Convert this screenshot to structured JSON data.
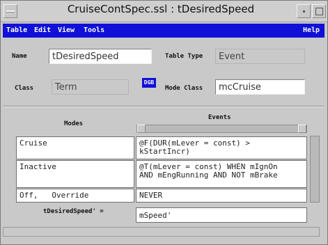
{
  "window": {
    "title": "CruiseContSpec.ssl : tDesiredSpeed"
  },
  "menubar": {
    "items": [
      "Table",
      "Edit",
      "View",
      "Tools"
    ],
    "help": "Help"
  },
  "form": {
    "name_label": "Name",
    "name_value": "tDesiredSpeed",
    "table_type_label": "Table Type",
    "table_type_value": "Event",
    "class_label": "Class",
    "class_value": "Term",
    "dgb_label": "DGB",
    "mode_class_label": "Mode Class",
    "mode_class_value": "mcCruise"
  },
  "table": {
    "modes_header": "Modes",
    "events_header": "Events",
    "rows": [
      {
        "mode": "Cruise",
        "event": "@F(DUR(mLever = const) >\nkStartIncr)"
      },
      {
        "mode": "Inactive",
        "event": "@T(mLever = const) WHEN mIgnOn\nAND mEngRunning AND NOT mBrake"
      },
      {
        "mode": "Off,   Override",
        "event": "NEVER"
      }
    ],
    "result_label": "tDesiredSpeed' =",
    "result_value": "mSpeed'"
  }
}
